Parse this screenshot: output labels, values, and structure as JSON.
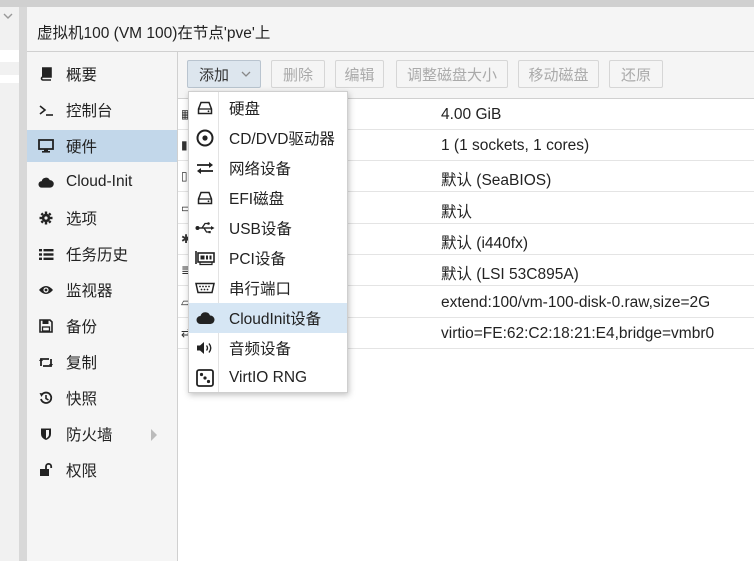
{
  "title": "虚拟机100 (VM 100)在节点'pve'上",
  "nav": {
    "items": [
      {
        "label": "概要",
        "icon": "book-icon"
      },
      {
        "label": "控制台",
        "icon": "terminal-icon"
      },
      {
        "label": "硬件",
        "icon": "monitor-icon",
        "active": true
      },
      {
        "label": "Cloud-Init",
        "icon": "cloud-icon"
      },
      {
        "label": "选项",
        "icon": "gear-icon"
      },
      {
        "label": "任务历史",
        "icon": "list-icon"
      },
      {
        "label": "监视器",
        "icon": "eye-icon"
      },
      {
        "label": "备份",
        "icon": "floppy-icon"
      },
      {
        "label": "复制",
        "icon": "retweet-icon"
      },
      {
        "label": "快照",
        "icon": "history-icon"
      },
      {
        "label": "防火墙",
        "icon": "shield-icon",
        "has_submenu": true
      },
      {
        "label": "权限",
        "icon": "unlock-icon"
      }
    ]
  },
  "toolbar": {
    "add_label": "添加",
    "delete_label": "删除",
    "edit_label": "编辑",
    "resize_label": "调整磁盘大小",
    "move_label": "移动磁盘",
    "revert_label": "还原"
  },
  "hardware": {
    "rows": [
      {
        "value": "4.00 GiB"
      },
      {
        "value": "1 (1 sockets, 1 cores)"
      },
      {
        "value": "默认 (SeaBIOS)"
      },
      {
        "value": "默认"
      },
      {
        "value": "默认 (i440fx)"
      },
      {
        "value": "默认 (LSI 53C895A)"
      },
      {
        "value": "extend:100/vm-100-disk-0.raw,size=2G"
      },
      {
        "value": "virtio=FE:62:C2:18:21:E4,bridge=vmbr0"
      }
    ]
  },
  "add_menu": {
    "items": [
      {
        "label": "硬盘",
        "icon": "hdd-icon"
      },
      {
        "label": "CD/DVD驱动器",
        "icon": "disc-icon"
      },
      {
        "label": "网络设备",
        "icon": "exchange-icon"
      },
      {
        "label": "EFI磁盘",
        "icon": "hdd-icon"
      },
      {
        "label": "USB设备",
        "icon": "usb-icon"
      },
      {
        "label": "PCI设备",
        "icon": "pci-card-icon"
      },
      {
        "label": "串行端口",
        "icon": "serial-port-icon"
      },
      {
        "label": "CloudInit设备",
        "icon": "cloud-icon",
        "active": true
      },
      {
        "label": "音频设备",
        "icon": "volume-icon"
      },
      {
        "label": "VirtIO RNG",
        "icon": "dice-icon"
      }
    ]
  },
  "colors": {
    "selected_bg": "#c2d7ea",
    "hover_bg": "#d6e6f4"
  }
}
